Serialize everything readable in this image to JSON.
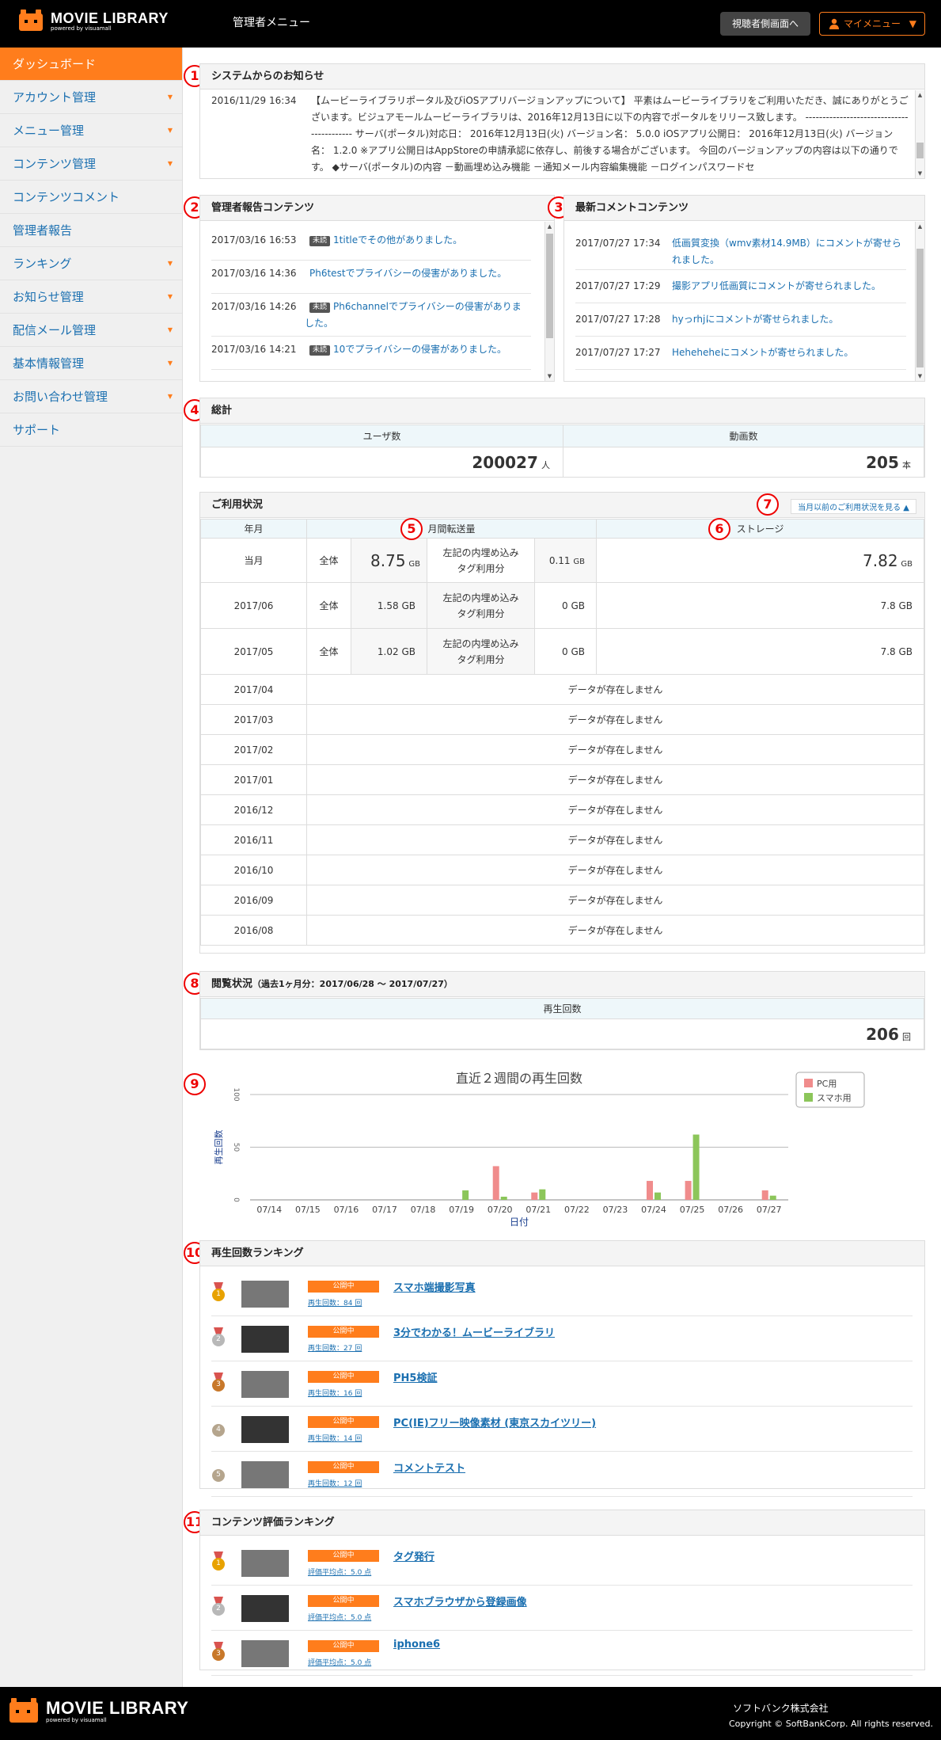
{
  "header": {
    "logo": "MOVIE LIBRARY",
    "logo_sub": "powered by visuamall",
    "title": "管理者メニュー",
    "viewer_btn": "視聴者側画面へ",
    "mymenu_btn": "マイメニュー"
  },
  "sidebar": {
    "items": [
      {
        "label": "ダッシュボード",
        "arrow": false
      },
      {
        "label": "アカウント管理",
        "arrow": true
      },
      {
        "label": "メニュー管理",
        "arrow": true
      },
      {
        "label": "コンテンツ管理",
        "arrow": true
      },
      {
        "label": "コンテンツコメント",
        "arrow": false
      },
      {
        "label": "管理者報告",
        "arrow": false
      },
      {
        "label": "ランキング",
        "arrow": true
      },
      {
        "label": "お知らせ管理",
        "arrow": true
      },
      {
        "label": "配信メール管理",
        "arrow": true
      },
      {
        "label": "基本情報管理",
        "arrow": true
      },
      {
        "label": "お問い合わせ管理",
        "arrow": true
      },
      {
        "label": "サポート",
        "arrow": false
      }
    ]
  },
  "markers": [
    "1",
    "2",
    "3",
    "4",
    "5",
    "6",
    "7",
    "8",
    "9",
    "10",
    "11"
  ],
  "notices": {
    "title": "システムからのお知らせ",
    "date": "2016/11/29 16:34",
    "text": "【ムービーライブラリポータル及びiOSアプリバージョンアップについて】 平素はムービーライブラリをご利用いただき、誠にありがとうございます。ビジュアモールムービーライブラリは、2016年12月13日に以下の内容でポータルをリリース致します。 ------------------------------------------ サーバ(ポータル)対応日： 2016年12月13日(火) バージョン名： 5.0.0 iOSアプリ公開日： 2016年12月13日(火) バージョン名： 1.2.0 ※アプリ公開日はAppStoreの申請承認に依存し、前後する場合がございます。 今回のバージョンアップの内容は以下の通りです。 ◆サーバ(ポータル)の内容 －動画埋め込み機能 －通知メール内容編集機能 －ログインパスワードセ"
  },
  "reports": {
    "title": "管理者報告コンテンツ",
    "badge": "未読",
    "items": [
      {
        "date": "2017/03/16 16:53",
        "text": "1titleでその他がありました。"
      },
      {
        "date": "2017/03/16 14:36",
        "text": "Ph6testでプライバシーの侵害がありました。"
      },
      {
        "date": "2017/03/16 14:26",
        "text": "Ph6channelでプライバシーの侵害がありました。"
      },
      {
        "date": "2017/03/16 14:21",
        "text": "10でプライバシーの侵害がありました。"
      }
    ]
  },
  "comments": {
    "title": "最新コメントコンテンツ",
    "items": [
      {
        "date": "2017/07/27 17:34",
        "text": "低画質変換（wmv素材14.9MB）にコメントが寄せられました。"
      },
      {
        "date": "2017/07/27 17:29",
        "text": "撮影アプリ低画質にコメントが寄せられました。"
      },
      {
        "date": "2017/07/27 17:28",
        "text": "hyっrhjにコメントが寄せられました。"
      },
      {
        "date": "2017/07/27 17:27",
        "text": "Heheheheにコメントが寄せられました。"
      }
    ]
  },
  "totals": {
    "title": "総計",
    "users_label": "ユーザ数",
    "users": "200027",
    "users_unit": "人",
    "videos_label": "動画数",
    "videos": "205",
    "videos_unit": "本"
  },
  "usage": {
    "title": "ご利用状況",
    "past_link": "当月以前のご利用状況を見る ▲",
    "col_month": "年月",
    "col_transfer": "月間転送量",
    "col_storage": "ストレージ",
    "all": "全体",
    "embed_label": "左記の内埋め込みタグ利用分",
    "no_data": "データが存在しません",
    "current": {
      "month": "当月",
      "transfer": "8.75",
      "transfer_unit": "GB",
      "embed": "0.11",
      "embed_unit": "GB",
      "storage": "7.82",
      "storage_unit": "GB"
    },
    "rows": [
      {
        "month": "2017/06",
        "transfer": "1.58 GB",
        "embed": "0 GB",
        "storage": "7.8 GB"
      },
      {
        "month": "2017/05",
        "transfer": "1.02 GB",
        "embed": "0 GB",
        "storage": "7.8 GB"
      }
    ],
    "empty_months": [
      "2017/04",
      "2017/03",
      "2017/02",
      "2017/01",
      "2016/12",
      "2016/11",
      "2016/10",
      "2016/09",
      "2016/08"
    ]
  },
  "views": {
    "title": "閲覧状況",
    "period": "（過去1ヶ月分：2017/06/28 ～ 2017/07/27）",
    "label": "再生回数",
    "value": "206",
    "unit": "回"
  },
  "chart_data": {
    "type": "bar",
    "title": "直近２週間の再生回数",
    "xlabel": "日付",
    "ylabel": "再生回数",
    "ylim": [
      0,
      100
    ],
    "yticks": [
      "0",
      "50",
      "100"
    ],
    "categories": [
      "07/14",
      "07/15",
      "07/16",
      "07/17",
      "07/18",
      "07/19",
      "07/20",
      "07/21",
      "07/22",
      "07/23",
      "07/24",
      "07/25",
      "07/26",
      "07/27"
    ],
    "series": [
      {
        "name": "PC用",
        "color": "#f08c8c",
        "values": [
          0,
          0,
          0,
          0,
          0,
          0,
          32,
          7,
          0,
          0,
          18,
          18,
          0,
          9
        ]
      },
      {
        "name": "スマホ用",
        "color": "#8cc65a",
        "values": [
          0,
          0,
          0,
          0,
          0,
          9,
          3,
          10,
          0,
          0,
          7,
          62,
          0,
          4
        ]
      }
    ],
    "legend": "top-right"
  },
  "rank_play": {
    "title": "再生回数ランキング",
    "items": [
      {
        "rank": "1",
        "status": "公開中",
        "count": "再生回数：84 回",
        "title": "スマホ端撮影写真"
      },
      {
        "rank": "2",
        "status": "公開中",
        "count": "再生回数：27 回",
        "title": "3分でわかる！ムービーライブラリ"
      },
      {
        "rank": "3",
        "status": "公開中",
        "count": "再生回数：16 回",
        "title": "PH5検証"
      },
      {
        "rank": "4",
        "status": "公開中",
        "count": "再生回数：14 回",
        "title": "PC(IE)フリー映像素材 (東京スカイツリー)"
      },
      {
        "rank": "5",
        "status": "公開中",
        "count": "再生回数：12 回",
        "title": "コメントテスト"
      }
    ]
  },
  "rank_eval": {
    "title": "コンテンツ評価ランキング",
    "items": [
      {
        "rank": "1",
        "status": "公開中",
        "count": "評価平均点：5.0 点",
        "title": "タグ発行"
      },
      {
        "rank": "2",
        "status": "公開中",
        "count": "評価平均点：5.0 点",
        "title": "スマホブラウザから登録画像"
      },
      {
        "rank": "3",
        "status": "公開中",
        "count": "評価平均点：5.0 点",
        "title": "iphone6"
      }
    ]
  },
  "footer": {
    "logo": "MOVIE LIBRARY",
    "logo_sub": "powered by visuamall",
    "company": "ソフトバンク株式会社",
    "copyright": "Copyright © SoftBankCorp. All rights reserved."
  },
  "colors": {
    "accent": "#ff7d1c",
    "link": "#1a6fb0",
    "marker": "#e00000",
    "header_bg": "#000000"
  }
}
